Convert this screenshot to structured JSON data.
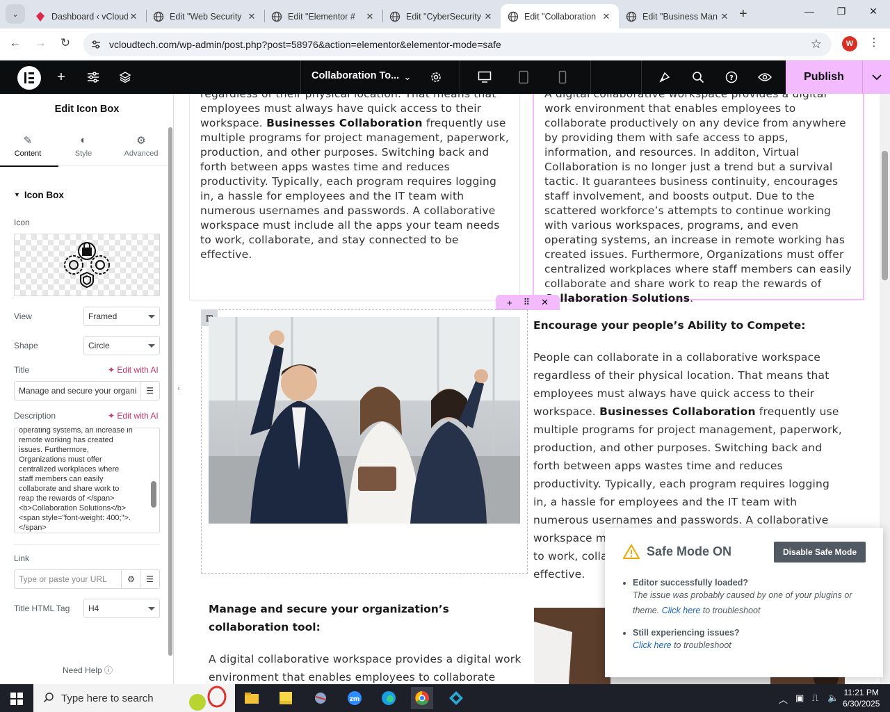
{
  "browser": {
    "tabs": [
      {
        "title": "Dashboard ‹ vCloud",
        "active": false
      },
      {
        "title": "Edit \"Web Security",
        "active": false
      },
      {
        "title": "Edit \"Elementor #",
        "active": false
      },
      {
        "title": "Edit \"CyberSecurity",
        "active": false
      },
      {
        "title": "Edit \"Collaboration",
        "active": true
      },
      {
        "title": "Edit \"Business Man",
        "active": false
      }
    ],
    "url": "vcloudtech.com/wp-admin/post.php?post=58976&action=elementor&elementor-mode=safe",
    "profile_initial": "W"
  },
  "editor": {
    "document_title": "Collaboration To...",
    "publish_label": "Publish"
  },
  "panel": {
    "title": "Edit Icon Box",
    "tabs": [
      {
        "label": "Content",
        "icon": "pencil-icon",
        "active": true
      },
      {
        "label": "Style",
        "icon": "half-circle-icon",
        "active": false
      },
      {
        "label": "Advanced",
        "icon": "gear-icon",
        "active": false
      }
    ],
    "section": "Icon Box",
    "icon_label": "Icon",
    "view_label": "View",
    "view_value": "Framed",
    "shape_label": "Shape",
    "shape_value": "Circle",
    "title_label": "Title",
    "edit_with_ai": "Edit with AI",
    "title_value": "Manage and secure your organi",
    "description_label": "Description",
    "description_value": "operating systems, an increase in\nremote working has created\nissues. Furthermore,\nOrganizations must offer\ncentralized workplaces where\nstaff members can easily\ncollaborate and share work to\nreap the rewards of </span>\n<b>Collaboration Solutions</b>\n<span style=\"font-weight: 400;\">.\n</span>",
    "link_label": "Link",
    "link_placeholder": "Type or paste your URL",
    "html_tag_label": "Title HTML Tag",
    "html_tag_value": "H4",
    "need_help": "Need Help"
  },
  "canvas": {
    "top_left_lines": [
      "regardless of their physical location. That means that",
      "employees must always have quick access to their"
    ],
    "top_left_bold": "Businesses Collaboration",
    "top_left_pre": "workspace.",
    "top_left_rest": "frequently use multiple programs for project management, paperwork, production, and other purposes. Switching back and forth between apps wastes time and reduces productivity. Typically, each program requires logging in, a hassle for employees and the IT team with numerous usernames and passwords. A collaborative workspace must include all the apps your team needs to work, collaborate, and stay connected to be effective.",
    "top_right_text": "A digital collaborative workspace provides a digital work environment that enables employees to collaborate productively on any device from anywhere by providing them with safe access to apps, information, and resources. In additon, Virtual Collaboration is no longer just a trend but a survival tactic. It guarantees business continuity, encourages staff involvement, and boosts output. Due to the scattered workforce’s attempts to continue working with various workspaces, programs, and even operating systems, an increase in remote working has created issues. Furthermore, Organizations must offer centralized workplaces where staff members can easily collaborate and share work to reap the",
    "top_right_pre": "rewards of",
    "top_right_bold": "Collaboration Solutions",
    "mid_heading": "Encourage your people’s Ability to Compete:",
    "mid_text_1": "People can collaborate in a collaborative workspace regardless of their physical location. That means that employees must always have quick access to their workspace.",
    "mid_bold": "Businesses Collaboration",
    "mid_text_2": "frequently use multiple programs for project management, paperwork, production, and other purposes. Switching back and forth between apps wastes time and reduces productivity. Typically, each program requires logging in, a hassle for employees and the IT team with numerous usernames and passwords. A collaborative workspace must include all the apps your team needs to work, collaborate, and stay connected to be effective.",
    "lower_heading": "Manage and secure your organization’s collaboration tool:",
    "lower_text": "A digital collaborative workspace provides a digital work environment that enables employees to collaborate"
  },
  "safe_mode": {
    "title": "Safe Mode ON",
    "disable_label": "Disable Safe Mode",
    "q1": "Editor successfully loaded?",
    "a1_pre": "The issue was probably caused by one of your plugins or theme.",
    "a1_link": "Click here",
    "a1_post": "to troubleshoot",
    "q2": "Still experiencing issues?",
    "a2_link": "Click here",
    "a2_post": "to troubleshoot"
  },
  "taskbar": {
    "search_placeholder": "Type here to search",
    "time": "11:21 PM",
    "date": "6/30/2025"
  },
  "colors": {
    "elementor_pink": "#f3bafd",
    "editor_black": "#0c0d0e",
    "accent_link": "#c36",
    "taskbar": "#1d2029"
  }
}
